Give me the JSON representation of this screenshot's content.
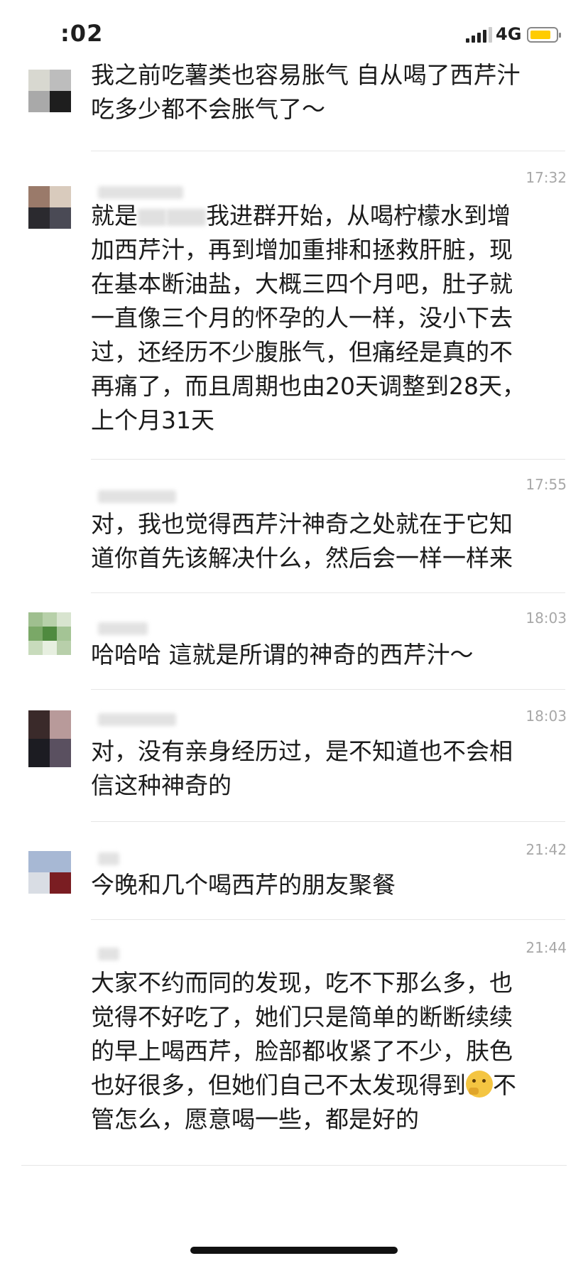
{
  "status_bar": {
    "time": ":02",
    "network": "4G",
    "battery_color": "#ffcc00"
  },
  "messages": [
    {
      "timestamp": "",
      "text_lines": [
        "我之前吃薯类也容易胀气 自从喝了西芹汁",
        "吃多少都不会胀气了～"
      ]
    },
    {
      "timestamp": "17:32",
      "text_lines": [
        "就是",
        "我进群开始，从喝柠檬水到增",
        "加西芹汁，再到增加重排和拯救肝脏，现",
        "在基本断油盐，大概三四个月吧，肚子就",
        "一直像三个月的怀孕的人一样，没小下去",
        "过，还经历不少腹胀气，但痛经是真的不",
        "再痛了，而且周期也由20天调整到28天，",
        "上个月31天"
      ]
    },
    {
      "timestamp": "17:55",
      "text_lines": [
        "对，我也觉得西芹汁神奇之处就在于它知",
        "道你首先该解决什么，然后会一样一样来"
      ]
    },
    {
      "timestamp": "18:03",
      "text_lines": [
        "哈哈哈 這就是所谓的神奇的西芹汁～"
      ]
    },
    {
      "timestamp": "18:03",
      "text_lines": [
        "对，没有亲身经历过，是不知道也不会相",
        "信这种神奇的"
      ]
    },
    {
      "timestamp": "21:42",
      "text_lines": [
        "今晚和几个喝西芹的朋友聚餐"
      ]
    },
    {
      "timestamp": "21:44",
      "text_lines": [
        "大家不约而同的发现，吃不下那么多，也",
        "觉得不好吃了，她们只是简单的断断续续",
        "的早上喝西芹，脸部都收紧了不少，肤色",
        "也好很多，但她们自己不太发现得到",
        "不",
        "管怎么，愿意喝一些，都是好的"
      ]
    }
  ],
  "icons": {
    "thinking_emoji": "thinking-face-icon"
  }
}
